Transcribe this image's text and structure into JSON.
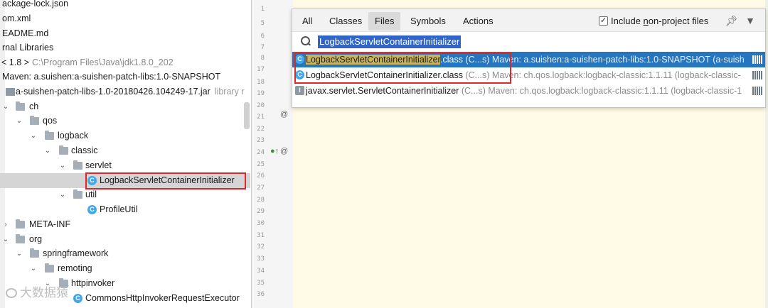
{
  "tree": {
    "rows": [
      {
        "label": "package-lock.json",
        "display": "ackage-lock.json"
      },
      {
        "label": "pom.xml",
        "display": "om.xml"
      },
      {
        "label": "README.md",
        "display": "EADME.md"
      },
      {
        "label": "External Libraries",
        "display": "rnal Libraries"
      },
      {
        "label": "< 1.8 >",
        "display": "< 1.8 >",
        "suffix": "C:\\Program Files\\Java\\jdk1.8.0_202"
      },
      {
        "label": "Maven: a.suishen:a-suishen-patch-libs:1.0-SNAPSHOT",
        "display": "Maven: a.suishen:a-suishen-patch-libs:1.0-SNAPSHOT"
      },
      {
        "label": "a-suishen-patch-libs-1.0-20180426.104249-17.jar",
        "suffix": "library r"
      },
      {
        "label": "ch"
      },
      {
        "label": "qos"
      },
      {
        "label": "logback"
      },
      {
        "label": "classic"
      },
      {
        "label": "servlet"
      },
      {
        "label": "LogbackServletContainerInitializer"
      },
      {
        "label": "util"
      },
      {
        "label": "ProfileUtil"
      },
      {
        "label": "META-INF"
      },
      {
        "label": "org"
      },
      {
        "label": "springframework"
      },
      {
        "label": "remoting"
      },
      {
        "label": "httpinvoker"
      },
      {
        "label": "CommonsHttpInvokerRequestExecutor"
      }
    ]
  },
  "gutter": {
    "line_numbers": [
      "1",
      "5",
      "6",
      "7",
      "8",
      "17",
      "18",
      "19",
      "20",
      "21",
      "22",
      "23",
      "24",
      "25",
      "26",
      "27",
      "28",
      "29",
      "30",
      "31",
      "32",
      "33",
      "34",
      "35",
      "36"
    ],
    "marks": [
      "@",
      "@"
    ]
  },
  "search_popup": {
    "tabs": [
      {
        "label": "All"
      },
      {
        "label": "Classes"
      },
      {
        "label": "Files",
        "active": true
      },
      {
        "label": "Symbols"
      },
      {
        "label": "Actions"
      }
    ],
    "include_non_project": {
      "checked": true,
      "label_before": "Include ",
      "label_underlined": "n",
      "label_after": "on-project files"
    },
    "query": "LogbackServletContainerInitializer",
    "results": [
      {
        "name_highlight": "LogbackServletContainerInitializer",
        "name_rest": ".class",
        "location": " (C...s) Maven: a.suishen:a-suishen-patch-libs:1.0-SNAPSHOT (a-suish",
        "selected": true,
        "icon": "class-icon"
      },
      {
        "name_highlight": "",
        "name_rest": "LogbackServletContainerInitializer.class",
        "location": " (C...s) Maven: ch.qos.logback:logback-classic:1.1.11 (logback-classic-",
        "selected": false,
        "icon": "class-icon"
      },
      {
        "name_highlight": "",
        "name_rest": "javax.servlet.ServletContainerInitializer",
        "location": " (C...s) Maven: ch.qos.logback:logback-classic:1.1.11 (logback-classic-1",
        "selected": false,
        "icon": "interface-icon"
      }
    ]
  },
  "watermark": {
    "text": "大数据猿"
  },
  "colors": {
    "selection": "#2675bf",
    "highlight": "#c9b35f",
    "annotation": "#e0262b",
    "editor_bg": "#fffbe6"
  }
}
